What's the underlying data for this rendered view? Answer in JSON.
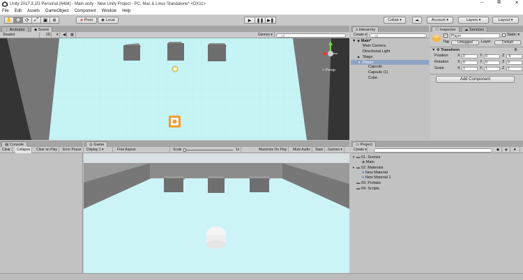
{
  "window": {
    "title": "Unity 2017.3.1f1 Personal (64bit) - Main.unity - New Unity Project - PC, Mac & Linux Standalone* <DX11>",
    "controls": [
      "–",
      "⧉",
      "✕"
    ]
  },
  "menu": [
    "File",
    "Edit",
    "Assets",
    "GameObject",
    "Component",
    "Window",
    "Help"
  ],
  "toolbar": {
    "tools": [
      "✋",
      "✥",
      "⟳",
      "⤢",
      "▣",
      "⊕"
    ],
    "pivot": "Pivot",
    "local": "Local",
    "play": "▶",
    "pause": "❚❚",
    "step": "▶❚",
    "collab": "Collab ▾",
    "cloud": "☁",
    "account": "Account ▾",
    "layers": "Layers ▾",
    "layout": "Layout ▾"
  },
  "scene": {
    "tabs": [
      "Animator",
      "Scene"
    ],
    "shading": "Shaded",
    "mode_2d": "2D",
    "gizmos": "Gizmos ▾",
    "search": "All",
    "persp": "< Persp"
  },
  "hierarchy": {
    "tab": "Hierarchy",
    "create": "Create ▾",
    "search": "All",
    "scene_name": "Main*",
    "items": [
      {
        "label": "Main Camera",
        "indent": 1,
        "selected": false,
        "arrow": ""
      },
      {
        "label": "Directional Light",
        "indent": 1,
        "selected": false,
        "arrow": ""
      },
      {
        "label": "Stage",
        "indent": 1,
        "selected": false,
        "arrow": "▶"
      },
      {
        "label": "Player",
        "indent": 1,
        "selected": true,
        "arrow": "▼"
      },
      {
        "label": "Capsule",
        "indent": 2,
        "selected": false,
        "arrow": ""
      },
      {
        "label": "Capsule (1)",
        "indent": 2,
        "selected": false,
        "arrow": ""
      },
      {
        "label": "Cube",
        "indent": 2,
        "selected": false,
        "arrow": ""
      }
    ]
  },
  "inspector": {
    "tabs": [
      "Inspector",
      "Services"
    ],
    "object_name": "Player",
    "static": "Static ▾",
    "tag_label": "Tag",
    "tag_value": "Untagged",
    "layer_label": "Layer",
    "layer_value": "Default",
    "component": "Transform",
    "position": {
      "label": "Position",
      "x": "0",
      "y": "0",
      "z": "-5"
    },
    "rotation": {
      "label": "Rotation",
      "x": "0",
      "y": "0",
      "z": "0"
    },
    "scale": {
      "label": "Scale",
      "x": "1",
      "y": "1",
      "z": "1"
    },
    "add_component": "Add Component"
  },
  "console": {
    "tab": "Console",
    "buttons": [
      "Clear",
      "Collapse",
      "Clear on Play",
      "Error Pause"
    ]
  },
  "game": {
    "tab": "Game",
    "display": "Display 1 ▾",
    "aspect": "Free Aspect",
    "scale_label": "Scale",
    "scale_value": "1x",
    "buttons": [
      "Maximize On Play",
      "Mute Audio",
      "Stats",
      "Gizmos ▾"
    ]
  },
  "project": {
    "tab": "Project",
    "create": "Create ▾",
    "items": [
      {
        "label": "01. Scenes",
        "indent": 0,
        "type": "folder",
        "arrow": "▼"
      },
      {
        "label": "Main",
        "indent": 1,
        "type": "scene",
        "arrow": ""
      },
      {
        "label": "02. Materials",
        "indent": 0,
        "type": "folder",
        "arrow": "▼"
      },
      {
        "label": "New Material",
        "indent": 1,
        "type": "material",
        "arrow": ""
      },
      {
        "label": "New Material 1",
        "indent": 1,
        "type": "material",
        "arrow": ""
      },
      {
        "label": "03. Prefabs",
        "indent": 0,
        "type": "folder",
        "arrow": ""
      },
      {
        "label": "04. Scripts",
        "indent": 0,
        "type": "folder",
        "arrow": ""
      }
    ]
  }
}
